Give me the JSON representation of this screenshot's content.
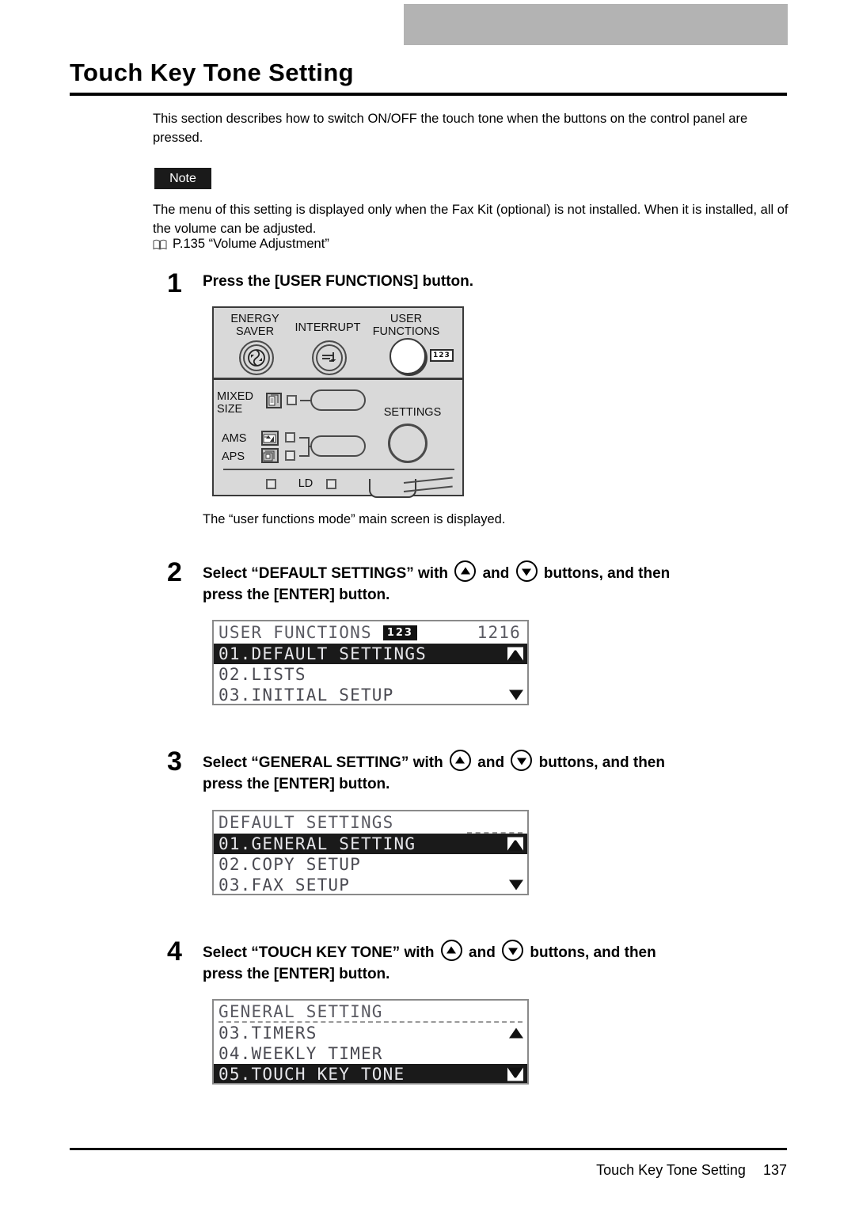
{
  "page": {
    "title": "Touch Key Tone Setting",
    "intro": "This section describes how to switch ON/OFF the touch tone when the buttons on the control panel are pressed.",
    "note_label": "Note",
    "note_body": "The menu of this setting is displayed only when the Fax Kit (optional) is not installed. When it is installed, all of the volume can be adjusted.",
    "reference": "P.135 “Volume Adjustment”"
  },
  "steps": [
    {
      "number": "1",
      "text": "Press the [USER FUNCTIONS] button.",
      "caption": "The “user functions mode” main screen is displayed."
    },
    {
      "number": "2",
      "text_a": "Select “DEFAULT SETTINGS” with",
      "text_b": "and",
      "text_c": "buttons, and then",
      "text_d": "press the [ENTER] button."
    },
    {
      "number": "3",
      "text_a": "Select “GENERAL SETTING” with",
      "text_b": "and",
      "text_c": "buttons, and then",
      "text_d": "press the [ENTER] button."
    },
    {
      "number": "4",
      "text_a": "Select “TOUCH KEY TONE” with",
      "text_b": "and",
      "text_c": "buttons, and then",
      "text_d": "press the [ENTER] button."
    }
  ],
  "control_panel": {
    "energy_saver_l1": "ENERGY",
    "energy_saver_l2": "SAVER",
    "interrupt": "INTERRUPT",
    "user_functions_l1": "USER",
    "user_functions_l2": "FUNCTIONS",
    "badge": "123",
    "mixed_size_l1": "MIXED",
    "mixed_size_l2": "SIZE",
    "ams": "AMS",
    "aps": "APS",
    "settings": "SETTINGS",
    "ld": "LD"
  },
  "lcd_screens": [
    {
      "id": "user-functions-screen",
      "header": "USER FUNCTIONS",
      "header_badge": "123",
      "header_value": "1216",
      "rows": [
        {
          "label": "01.DEFAULT SETTINGS",
          "selected": true,
          "indicator": "up"
        },
        {
          "label": "02.LISTS",
          "selected": false,
          "indicator": ""
        },
        {
          "label": "03.INITIAL SETUP",
          "selected": false,
          "indicator": "down"
        }
      ]
    },
    {
      "id": "default-settings-screen",
      "header": "DEFAULT SETTINGS",
      "header_badge": "",
      "header_value": "",
      "rows": [
        {
          "label": "01.GENERAL SETTING",
          "selected": true,
          "indicator": "up"
        },
        {
          "label": "02.COPY SETUP",
          "selected": false,
          "indicator": ""
        },
        {
          "label": "03.FAX SETUP",
          "selected": false,
          "indicator": "down"
        }
      ]
    },
    {
      "id": "general-setting-screen",
      "header": "GENERAL SETTING",
      "header_badge": "",
      "header_value": "",
      "rows": [
        {
          "label": "03.TIMERS",
          "selected": false,
          "indicator": "up"
        },
        {
          "label": "04.WEEKLY TIMER",
          "selected": false,
          "indicator": ""
        },
        {
          "label": "05.TOUCH KEY TONE",
          "selected": true,
          "indicator": "down"
        }
      ]
    }
  ],
  "footer": {
    "section": "Touch Key Tone Setting",
    "page_number": "137"
  }
}
